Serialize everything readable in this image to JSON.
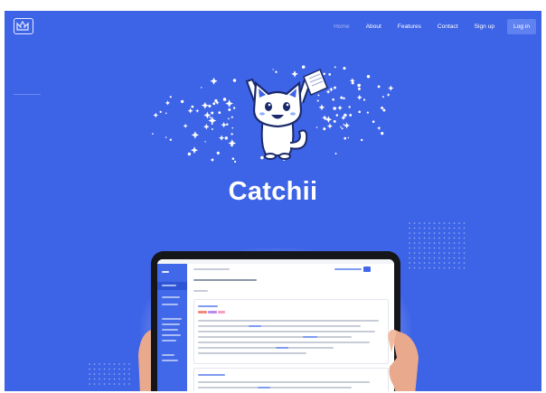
{
  "nav": {
    "items": [
      {
        "label": "Home",
        "active": true
      },
      {
        "label": "About",
        "active": false
      },
      {
        "label": "Features",
        "active": false
      },
      {
        "label": "Contact",
        "active": false
      },
      {
        "label": "Sign up",
        "active": false
      }
    ],
    "login_label": "Log in"
  },
  "hero": {
    "brand_name": "Catchii",
    "mascot_icon": "cat-mascot-icon"
  },
  "colors": {
    "background": "#3d63e6",
    "nav_text": "#ffffff",
    "nav_active": "#a8b8f2",
    "login_button": "#5f82f0",
    "app_sidebar": "#4168e8"
  }
}
